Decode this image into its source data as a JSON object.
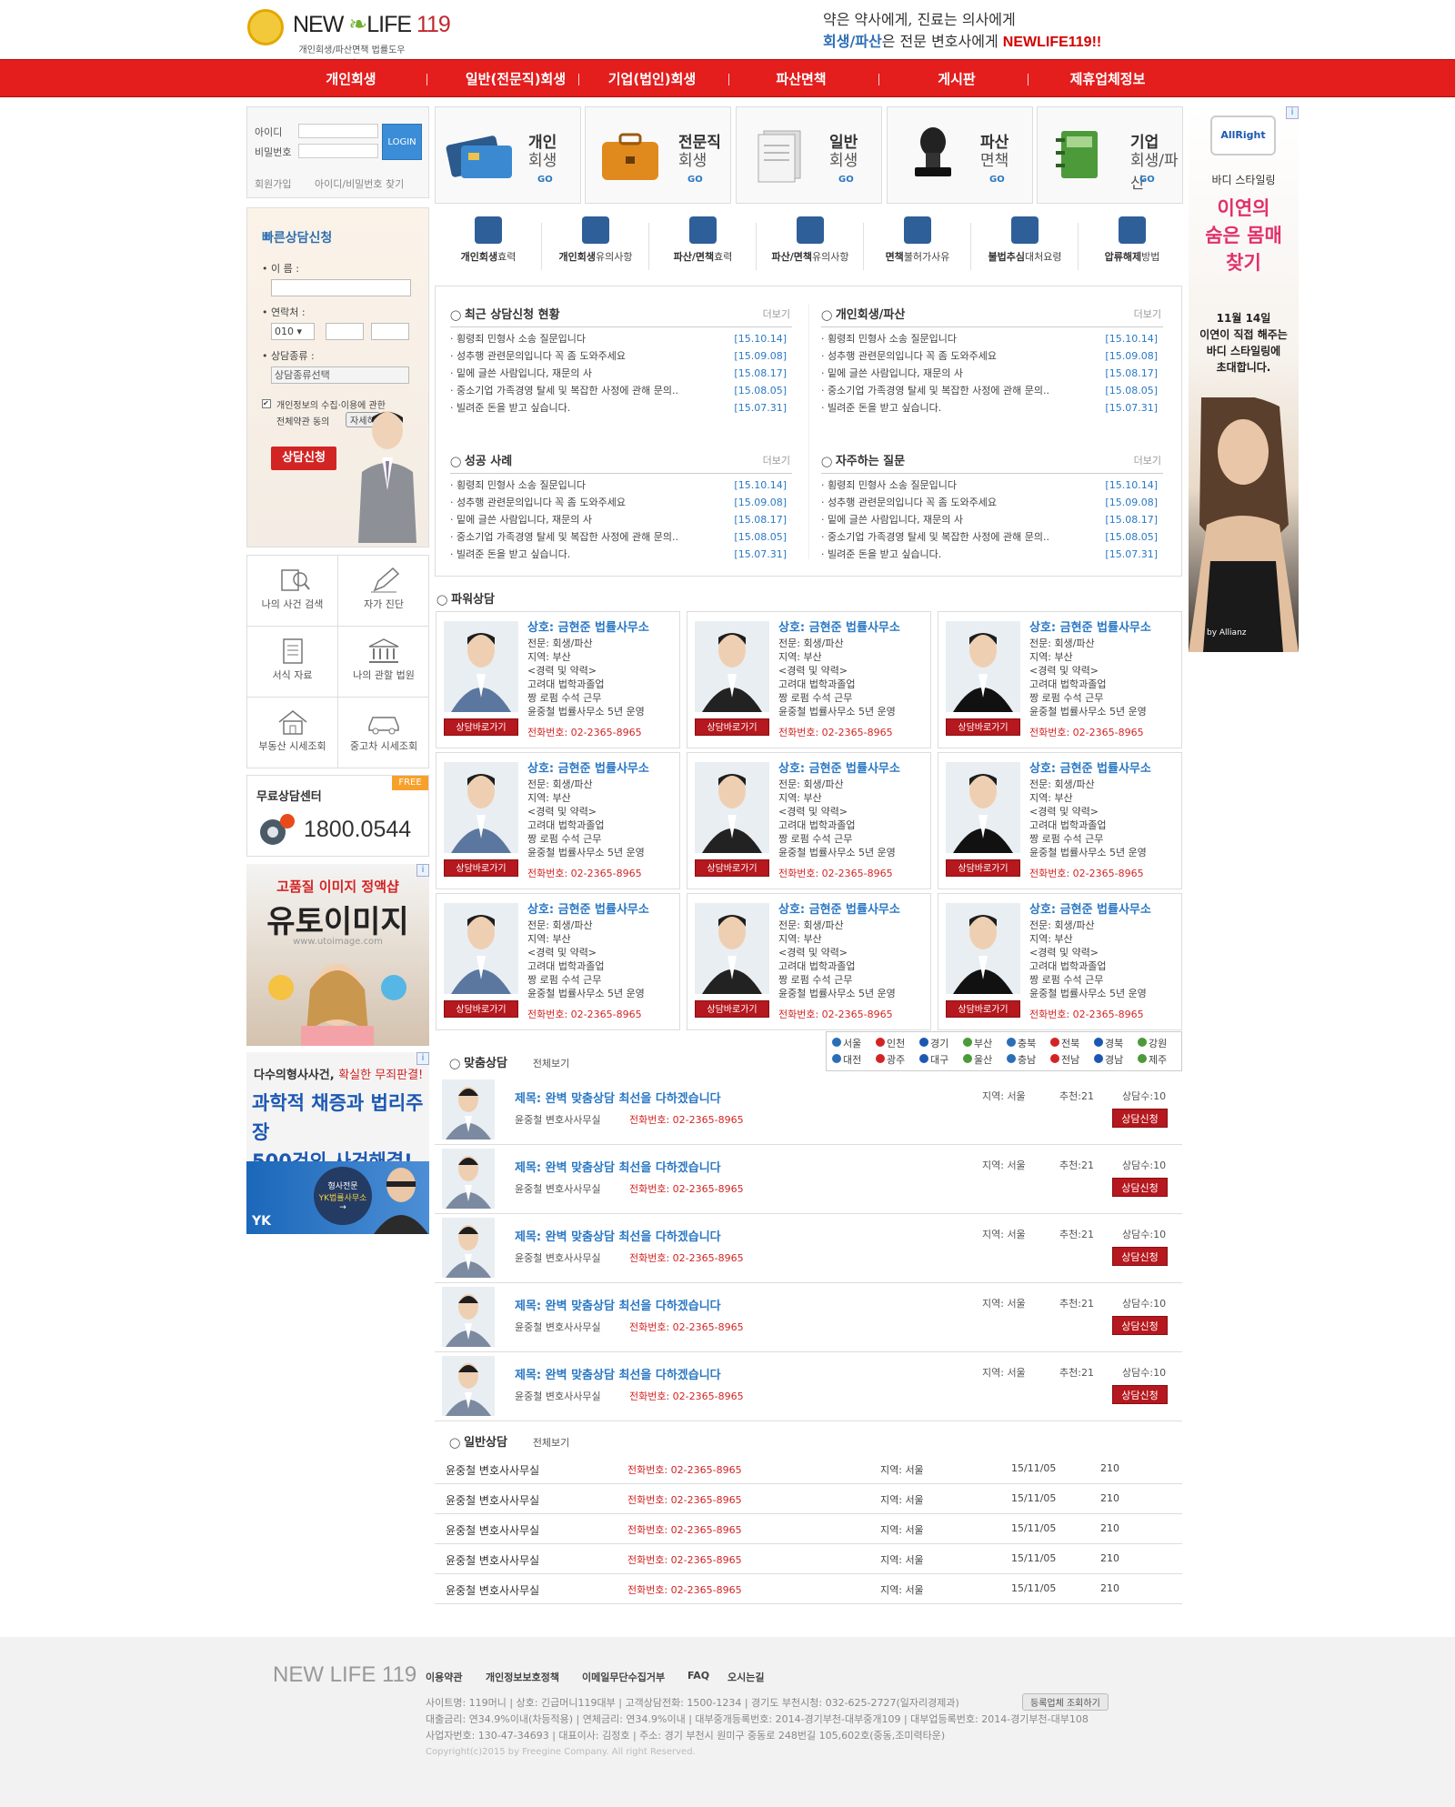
{
  "header": {
    "logo_new": "NEW",
    "logo_life": "LIFE",
    "logo_num": "119",
    "logo_sub": "개인회생/파산면책 법률도우미",
    "slogan_line1": "약은 약사에게, 진료는 의사에게",
    "slogan_hl": "회생/파산",
    "slogan_mid": "은 전문 변호사에게 ",
    "slogan_brand": "NEWLIFE119!!"
  },
  "nav": [
    "개인회생",
    "일반(전문직)회생",
    "기업(법인)회생",
    "파산면책",
    "게시판",
    "제휴업체정보"
  ],
  "login": {
    "id_label": "아이디",
    "pw_label": "비밀번호",
    "button": "LOGIN",
    "join": "회원가입",
    "find": "아이디/비밀번호 찾기"
  },
  "quick": {
    "title": "빠른상담신청",
    "name_label": "• 이    름 :",
    "phone_label": "• 연락처 :",
    "phone_prefix": "010  ▾",
    "type_label": "• 상담종류 :",
    "type_placeholder": "상담종류선택",
    "agree": "개인정보의 수집·이용에 관한",
    "agree2": "전체약관 동의",
    "detail": "자세히",
    "submit": "상담신청"
  },
  "icon_grid": [
    {
      "label": "나의 사건 검색",
      "icon": "search-doc-icon"
    },
    {
      "label": "자가 진단",
      "icon": "pen-icon"
    },
    {
      "label": "서식 자료",
      "icon": "document-icon"
    },
    {
      "label": "나의 관할 법원",
      "icon": "court-icon"
    },
    {
      "label": "부동산 시세조회",
      "icon": "house-icon"
    },
    {
      "label": "중고차 시세조회",
      "icon": "car-icon"
    }
  ],
  "free": {
    "title": "무료상담센터",
    "badge": "FREE",
    "number": "1800.0544"
  },
  "ad1": {
    "line1": "고품질 이미지 정액샵",
    "line2": "유토이미지",
    "url": "www.utoimage.com"
  },
  "ad2": {
    "line1_a": "다수의형사사건, ",
    "line1_b": "확실한 무죄판결!",
    "line2": "과학적 채증과 법리주장",
    "line3": "500건의 사건해결!",
    "badge1": "형사전문",
    "badge2": "YK법률사무소"
  },
  "categories": [
    {
      "n1": "개인",
      "n2": "회생",
      "go": "GO"
    },
    {
      "n1": "전문직",
      "n2": "회생",
      "go": "GO"
    },
    {
      "n1": "일반",
      "n2": "회생",
      "go": "GO"
    },
    {
      "n1": "파산",
      "n2": "면책",
      "go": "GO"
    },
    {
      "n1": "기업",
      "n2": "회생/파산",
      "go": "GO"
    }
  ],
  "subnav": [
    {
      "b": "개인회생",
      "r": "효력"
    },
    {
      "b": "개인회생",
      "r": "유의사항"
    },
    {
      "b": "파산/면책",
      "r": "효력"
    },
    {
      "b": "파산/면책",
      "r": "유의사항"
    },
    {
      "b": "면책",
      "r": "불허가사유"
    },
    {
      "b": "불법추심",
      "r": "대처요령"
    },
    {
      "b": "압류해제",
      "r": "방법"
    }
  ],
  "boards": [
    {
      "title": "최근 상담신청 현황",
      "more": "더보기"
    },
    {
      "title": "개인회생/파산",
      "more": "더보기"
    },
    {
      "title": "성공 사례",
      "more": "더보기"
    },
    {
      "title": "자주하는 질문",
      "more": "더보기"
    }
  ],
  "board_rows": [
    {
      "text": "· 횡령죄 민형사 소송 질문입니다",
      "date": "[15.10.14]"
    },
    {
      "text": "· 성추행 관련문의입니다 꼭 좀 도와주세요",
      "date": "[15.09.08]"
    },
    {
      "text": "· 밑에 글쓴 사람입니다, 재문의 사",
      "date": "[15.08.17]"
    },
    {
      "text": "· 중소기업 가족경영 탈세 및 복잡한 사정에 관해 문의..",
      "date": "[15.08.05]"
    },
    {
      "text": "· 빌려준 돈을 받고 싶습니다.",
      "date": "[15.07.31]"
    }
  ],
  "power": {
    "title": "파워상담",
    "name": "상호: 금현준 법률사무소",
    "field": "전문: 회생/파산",
    "region": "지역: 부산",
    "career": "<경력 및 약력>",
    "c1": "고려대 법학과졸업",
    "c2": "짱 로펌 수석 근무",
    "c3": "윤중철 법률사무소 5년 운영",
    "phone": "전화번호: 02-2365-8965",
    "btn": "상담바로가기"
  },
  "regions": [
    "서울",
    "인천",
    "경기",
    "부산",
    "충북",
    "전북",
    "경북",
    "강원",
    "대전",
    "광주",
    "대구",
    "울산",
    "충남",
    "전남",
    "경남",
    "제주"
  ],
  "match": {
    "title": "맞춤상담",
    "all": "전체보기",
    "subject": "제목: 완벽 맞춤상담 최선을 다하겠습니다",
    "office": "윤중철 변호사사무실",
    "phone": "전화번호: 02-2365-8965",
    "region": "지역: 서울",
    "rec": "추천:21",
    "count": "상담수:10",
    "btn": "상담신청"
  },
  "general": {
    "title": "일반상담",
    "all": "전체보기",
    "office": "윤중철 변호사사무실",
    "phone": "전화번호: 02-2365-8965",
    "region": "지역: 서울",
    "date": "15/11/05",
    "num": "210"
  },
  "right_ad": {
    "brand": "AllRight",
    "l1": "바디 스타일링",
    "l2": "이연의",
    "l3": "숨은 몸매",
    "l4": "찾기",
    "l5": "11월 14일",
    "l6": "이연이 직접 해주는",
    "l7": "바디 스타일링에",
    "l8": "초대합니다.",
    "sponsor": "by Allianz"
  },
  "footer": {
    "logo": "NEW LIFE 119",
    "links": [
      "이용약관",
      "개인정보보호정책",
      "이메일무단수집거부",
      "FAQ",
      "오시는길"
    ],
    "info1": "사이트명: 119머니  |  상호: 긴급머니119대부  |  고객상담전화: 1500-1234  |  경기도 부천시청: 032-625-2727(일자리경제과)",
    "reg_btn": "등록업체 조회하기",
    "info2": "대출금리: 연34.9%이내(차등적용)  |  연체금리: 연34.9%이내  |  대부중개등록번호: 2014-경기부천-대부중개109  |  대부업등록번호: 2014-경기부천-대부108",
    "info3": "사업자번호: 130-47-34693  |  대표이사: 김정호  |  주소: 경기 부천시 원미구 중동로 248번길 105,602호(중동,조미력타운)",
    "copy": "Copyright(c)2015 by Freegine Company. All right Reserved."
  },
  "colors": {
    "brand_red": "#e41d1d",
    "link_blue": "#2a78c4",
    "button_red": "#b5181e"
  }
}
